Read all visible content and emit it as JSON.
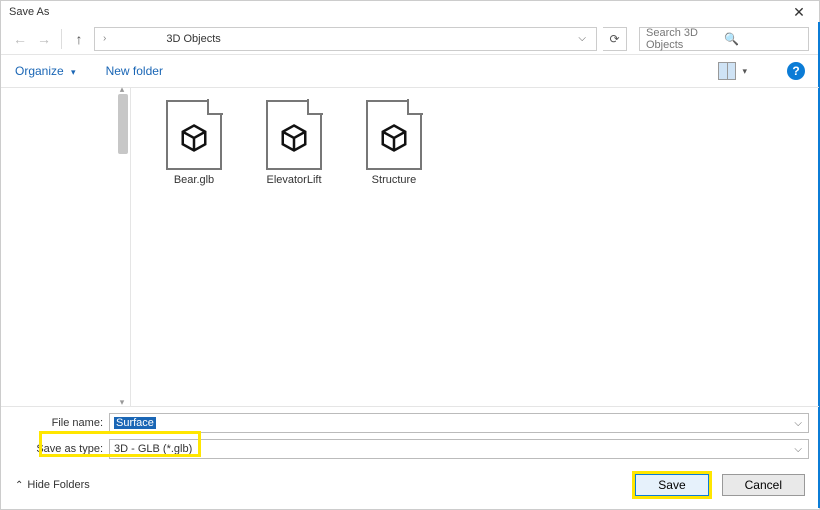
{
  "titlebar": {
    "title": "Save As",
    "close_glyph": "✕"
  },
  "nav": {
    "back_glyph": "←",
    "forward_glyph": "→",
    "up_glyph": "↑",
    "path_chevron": "›",
    "current_folder": "3D Objects",
    "dropdown_chevron": "⌵",
    "refresh_glyph": "⟳"
  },
  "search": {
    "placeholder": "Search 3D Objects",
    "icon_glyph": "🔍"
  },
  "toolbar": {
    "organize_label": "Organize",
    "newfolder_label": "New folder",
    "help_glyph": "?"
  },
  "files": [
    {
      "name": "Bear.glb"
    },
    {
      "name": "ElevatorLift"
    },
    {
      "name": "Structure"
    }
  ],
  "form": {
    "filename_label": "File name:",
    "filename_value": "Surface",
    "savetype_label": "Save as type:",
    "savetype_value": "3D - GLB (*.glb)"
  },
  "footer": {
    "hide_folders_label": "Hide Folders",
    "hide_chevron": "⌃",
    "save_label": "Save",
    "cancel_label": "Cancel"
  }
}
